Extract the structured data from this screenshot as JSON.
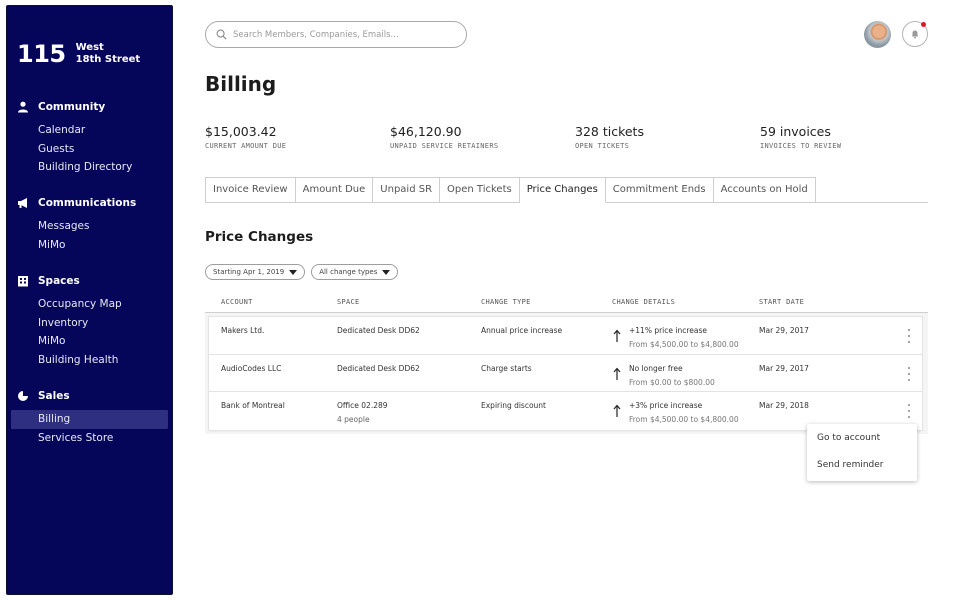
{
  "brand": {
    "number": "115",
    "line1": "West",
    "line2": "18th Street"
  },
  "sidebar": {
    "sections": [
      {
        "title": "Community",
        "icon": "person-icon",
        "items": [
          "Calendar",
          "Guests",
          "Building Directory"
        ]
      },
      {
        "title": "Communications",
        "icon": "megaphone-icon",
        "items": [
          "Messages",
          "MiMo"
        ]
      },
      {
        "title": "Spaces",
        "icon": "building-icon",
        "items": [
          "Occupancy Map",
          "Inventory",
          "MiMo",
          "Building Health"
        ]
      },
      {
        "title": "Sales",
        "icon": "pie-chart-icon",
        "items": [
          "Billing",
          "Services Store"
        ]
      }
    ],
    "active_item": "Billing"
  },
  "search": {
    "placeholder": "Search Members, Companies, Emails..."
  },
  "page": {
    "title": "Billing"
  },
  "stats": [
    {
      "value": "$15,003.42",
      "label": "CURRENT AMOUNT DUE"
    },
    {
      "value": "$46,120.90",
      "label": "UNPAID SERVICE RETAINERS"
    },
    {
      "value": "328 tickets",
      "label": "OPEN TICKETS"
    },
    {
      "value": "59 invoices",
      "label": "INVOICES TO REVIEW"
    }
  ],
  "tabs": [
    "Invoice Review",
    "Amount Due",
    "Unpaid SR",
    "Open Tickets",
    "Price Changes",
    "Commitment Ends",
    "Accounts on Hold"
  ],
  "active_tab": "Price Changes",
  "section": {
    "title": "Price Changes"
  },
  "filters": [
    "Starting Apr 1, 2019",
    "All change types"
  ],
  "table": {
    "columns": [
      "ACCOUNT",
      "SPACE",
      "CHANGE TYPE",
      "CHANGE DETAILS",
      "START DATE"
    ],
    "rows": [
      {
        "account": "Makers Ltd.",
        "space": "Dedicated Desk DD62",
        "space_sub": "",
        "change_type": "Annual price increase",
        "detail": "+11% price increase",
        "detail_sub": "From $4,500.00 to $4,800.00",
        "start": "Mar 29, 2017"
      },
      {
        "account": "AudioCodes LLC",
        "space": "Dedicated Desk DD62",
        "space_sub": "",
        "change_type": "Charge starts",
        "detail": "No longer free",
        "detail_sub": "From $0.00 to $800.00",
        "start": "Mar 29, 2017"
      },
      {
        "account": "Bank of Montreal",
        "space": "Office 02.289",
        "space_sub": "4 people",
        "change_type": "Expiring discount",
        "detail": "+3% price increase",
        "detail_sub": "From $4,500.00 to $4,800.00",
        "start": "Mar 29, 2018"
      }
    ]
  },
  "row_menu": {
    "items": [
      "Go to account",
      "Send reminder"
    ]
  },
  "colors": {
    "sidebar_bg": "#05065a",
    "active_item_bg": "#2f2f82",
    "notification_dot": "#e0172b"
  }
}
